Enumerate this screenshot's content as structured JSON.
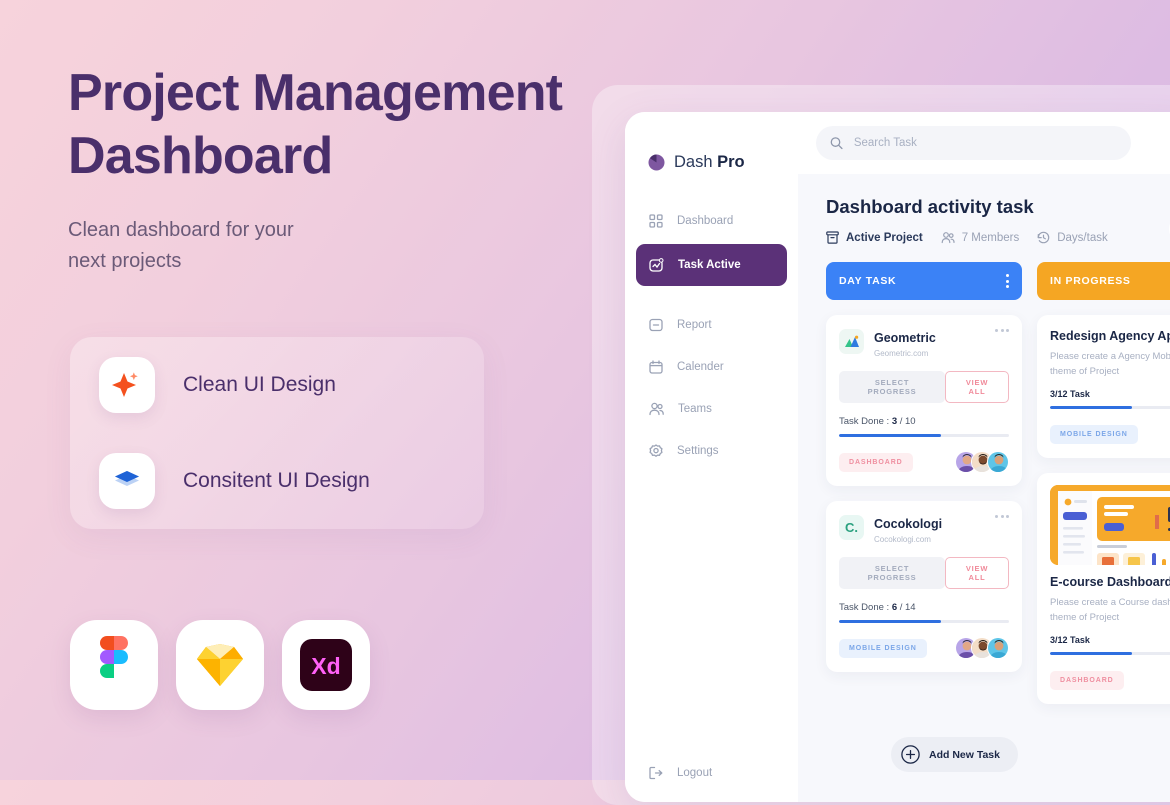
{
  "promo": {
    "title_line1": "Project Management",
    "title_line2": "Dashboard",
    "subtitle_line1": "Clean dashboard for your",
    "subtitle_line2": "next projects",
    "features": [
      {
        "label": "Clean UI Design",
        "icon": "sparkle-icon"
      },
      {
        "label": "Consitent UI Design",
        "icon": "layers-icon"
      }
    ],
    "tools": [
      "figma-logo",
      "sketch-logo",
      "adobe-xd-logo"
    ]
  },
  "sidebar": {
    "brand_name": "Dash ",
    "brand_bold": "Pro",
    "items": [
      {
        "label": "Dashboard",
        "icon": "grid-icon",
        "active": false
      },
      {
        "label": "Task Active",
        "icon": "task-icon",
        "active": true
      },
      {
        "label": "Report",
        "icon": "report-icon",
        "active": false
      },
      {
        "label": "Calender",
        "icon": "calendar-icon",
        "active": false
      },
      {
        "label": "Teams",
        "icon": "people-icon",
        "active": false
      },
      {
        "label": "Settings",
        "icon": "gear-icon",
        "active": false
      }
    ],
    "logout": "Logout"
  },
  "search": {
    "placeholder": "Search Task",
    "value": ""
  },
  "header": {
    "title": "Dashboard activity task",
    "meta": [
      {
        "label": "Active Project",
        "icon": "archive-icon"
      },
      {
        "label": "7 Members",
        "icon": "members-icon"
      },
      {
        "label": "Days/task",
        "icon": "clock-icon"
      }
    ]
  },
  "columns": [
    {
      "title": "DAY TASK",
      "color": "#3b82f6",
      "has_menu": true,
      "cards": [
        {
          "type": "project",
          "name": "Geometric",
          "url": "Geometric.com",
          "progress_btn": "SELECT PROGRESS",
          "view_btn": "VIEW ALL",
          "task_label": "Task Done : ",
          "done": "3",
          "total": " / 10",
          "progress_pct": 60,
          "tag": "DASHBOARD",
          "tag_style": "tag-dash",
          "avatars": 3
        },
        {
          "type": "project",
          "name": "Cocokologi",
          "url": "Cocokologi.com",
          "progress_btn": "SELECT PROGRESS",
          "view_btn": "VIEW ALL",
          "task_label": "Task Done : ",
          "done": "6",
          "total": " / 14",
          "progress_pct": 60,
          "tag": "MOBILE DESIGN",
          "tag_style": "tag-mob",
          "avatars": 3
        }
      ]
    },
    {
      "title": "IN PROGRESS",
      "color": "#f5a623",
      "has_menu": false,
      "cards": [
        {
          "type": "detail",
          "name": "Redesign Agency App",
          "desc": "Please create a Agency Mobile with the theme of Project",
          "task_count": "3/12 Task",
          "progress_pct": 48,
          "tag": "MOBILE DESIGN",
          "tag_style": "tag-mob",
          "has_thumb": false
        },
        {
          "type": "detail",
          "name": "E-course Dashboard",
          "desc": "Please create a Course dashboard theme of Project",
          "task_count": "3/12 Task",
          "progress_pct": 48,
          "tag": "DASHBOARD",
          "tag_style": "tag-dash",
          "has_thumb": true
        }
      ]
    }
  ],
  "add_task": {
    "label": "Add New Task"
  },
  "colors": {
    "accent_purple": "#5b3178",
    "title_purple": "#4a2f6b",
    "blue": "#3b82f6",
    "orange": "#f5a623",
    "pink_tag": "#ef8fa0"
  }
}
